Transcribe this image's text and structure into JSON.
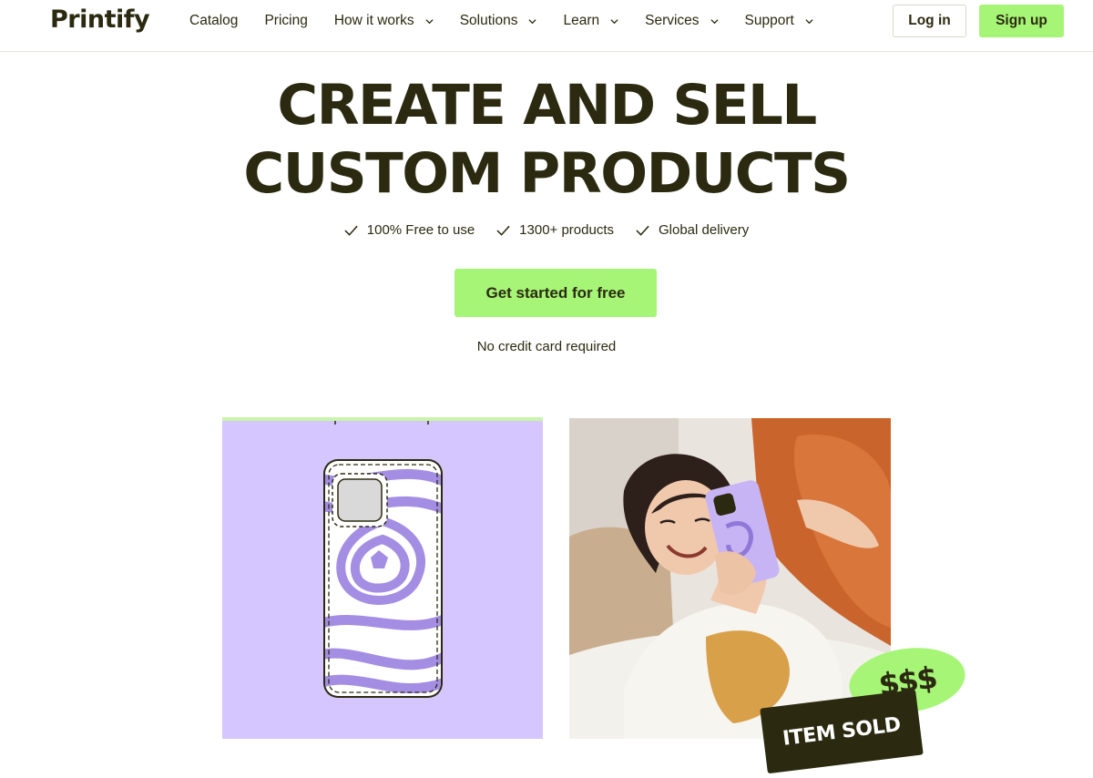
{
  "header": {
    "logo": "Printify",
    "nav": [
      {
        "label": "Catalog",
        "dropdown": false
      },
      {
        "label": "Pricing",
        "dropdown": false
      },
      {
        "label": "How it works",
        "dropdown": true
      },
      {
        "label": "Solutions",
        "dropdown": true
      },
      {
        "label": "Learn",
        "dropdown": true
      },
      {
        "label": "Services",
        "dropdown": true
      },
      {
        "label": "Support",
        "dropdown": true
      }
    ],
    "login_label": "Log in",
    "signup_label": "Sign up"
  },
  "hero": {
    "title_line1": "CREATE AND SELL",
    "title_line2": "CUSTOM PRODUCTS",
    "features": [
      "100% Free to use",
      "1300+ products",
      "Global delivery"
    ],
    "cta_label": "Get started for free",
    "cta_note": "No credit card required"
  },
  "showcase": {
    "sold_badge": "ITEM SOLD",
    "money_badge": "$$$"
  },
  "colors": {
    "accent_green": "#a6f577",
    "dark_olive": "#2b2a10",
    "lavender": "#d6c6ff",
    "purple_swirl": "#a48ee3"
  },
  "icons": {
    "check": "check-icon",
    "chevron": "chevron-down-icon"
  }
}
